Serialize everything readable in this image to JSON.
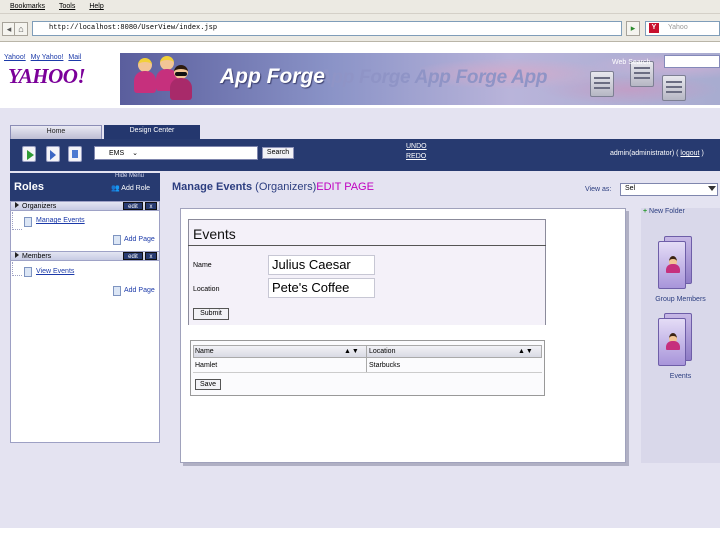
{
  "browser": {
    "menu": [
      "Bookmarks",
      "Tools",
      "Help"
    ],
    "url": "http://localhost:8080/UserView/index.jsp",
    "search_placeholder": "Yahoo"
  },
  "header": {
    "yahoo_links": [
      "Yahoo!",
      "My Yahoo!",
      "Mail"
    ],
    "logo": "YAHOO!",
    "app_title": "App Forge",
    "banner_echo": "App Forge App Forge App",
    "search_label": "Web Search"
  },
  "tabs": {
    "home": "Home",
    "design": "Design Center"
  },
  "toolbar": {
    "app_select": "EMS",
    "search_btn": "Search",
    "undo": "UNDO",
    "redo": "REDO",
    "user": "admin(administrator)",
    "logout": "logout"
  },
  "sidebar": {
    "hide_menu": "Hide Menu",
    "title": "Roles",
    "add_role": "Add Role",
    "edit": "edit",
    "x": "x",
    "roles": [
      {
        "name": "Organizers",
        "page": "Manage Events",
        "add_page": "Add Page"
      },
      {
        "name": "Members",
        "page": "View Events",
        "add_page": "Add Page"
      }
    ]
  },
  "main": {
    "title_bold": "Manage Events",
    "title_role": "(Organizers)",
    "title_edit": "EDIT PAGE",
    "view_as_label": "View as:",
    "view_as_value": "Sel"
  },
  "form": {
    "title": "Events",
    "name_label": "Name",
    "name_value": "Julius Caesar",
    "location_label": "Location",
    "location_value": "Pete's Coffee",
    "submit": "Submit"
  },
  "table": {
    "columns": [
      "Name",
      "Location"
    ],
    "sort_glyph": "▲▼",
    "rows": [
      {
        "name": "Hamlet",
        "location": "Starbucks"
      }
    ],
    "save": "Save"
  },
  "right_panel": {
    "new_folder": "New Folder",
    "folders": [
      "Group Members",
      "Events"
    ]
  },
  "colors": {
    "toolbar": "#273a70",
    "accent_link": "#1c3aa9",
    "edit_page": "#c000c0",
    "logo": "#7b0099"
  }
}
